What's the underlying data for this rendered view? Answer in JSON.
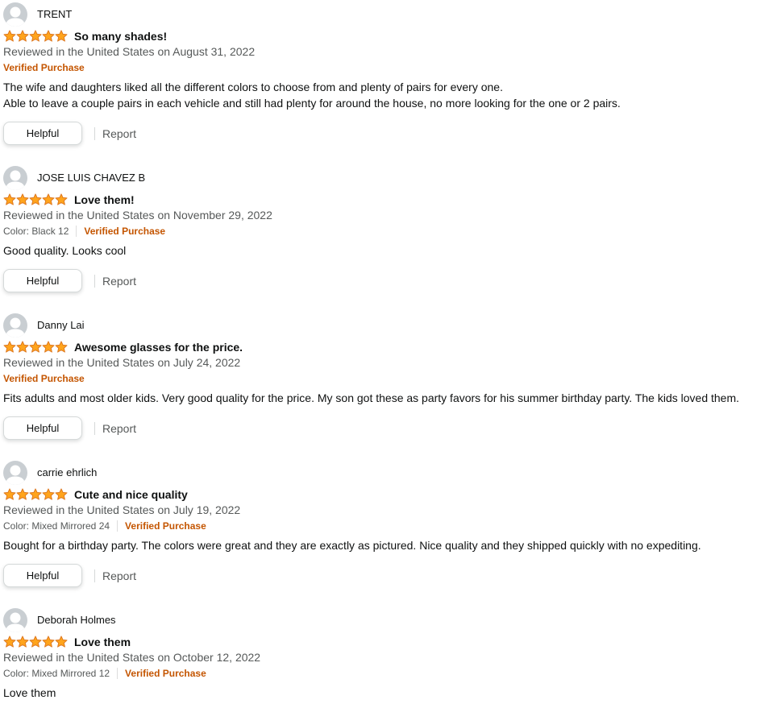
{
  "colors": {
    "star_fill": "#FFA41C",
    "star_stroke": "#DE7921",
    "verified": "#C45500",
    "secondary_text": "#565959"
  },
  "actions": {
    "helpful_label": "Helpful",
    "report_label": "Report"
  },
  "reviews": [
    {
      "profile_name": "TRENT",
      "rating": 5,
      "title": "So many shades!",
      "date": "Reviewed in the United States on August 31, 2022",
      "variant": "",
      "verified": "Verified Purchase",
      "body": [
        "The wife and daughters liked all the different colors to choose from and plenty of pairs for every one.",
        "Able to leave a couple pairs in each vehicle and still had plenty for around the house, no more looking for the one or 2 pairs."
      ]
    },
    {
      "profile_name": "JOSE LUIS CHAVEZ B",
      "rating": 5,
      "title": "Love them!",
      "date": "Reviewed in the United States on November 29, 2022",
      "variant": "Color: Black 12",
      "verified": "Verified Purchase",
      "body": [
        "Good quality. Looks cool"
      ]
    },
    {
      "profile_name": "Danny Lai",
      "rating": 5,
      "title": "Awesome glasses for the price.",
      "date": "Reviewed in the United States on July 24, 2022",
      "variant": "",
      "verified": "Verified Purchase",
      "body": [
        "Fits adults and most older kids. Very good quality for the price. My son got these as party favors for his summer birthday party. The kids loved them."
      ]
    },
    {
      "profile_name": "carrie ehrlich",
      "rating": 5,
      "title": "Cute and nice quality",
      "date": "Reviewed in the United States on July 19, 2022",
      "variant": "Color: Mixed Mirrored 24",
      "verified": "Verified Purchase",
      "body": [
        "Bought for a birthday party. The colors were great and they are exactly as pictured. Nice quality and they shipped quickly with no expediting."
      ]
    },
    {
      "profile_name": "Deborah Holmes",
      "rating": 5,
      "title": "Love them",
      "date": "Reviewed in the United States on October 12, 2022",
      "variant": "Color: Mixed Mirrored 12",
      "verified": "Verified Purchase",
      "body": [
        "Love them"
      ]
    }
  ]
}
